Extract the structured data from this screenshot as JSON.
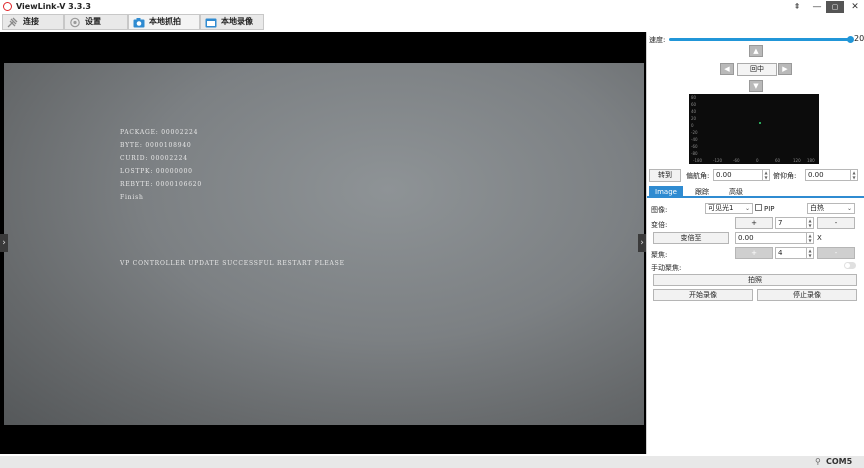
{
  "window": {
    "title": "ViewLink-V 3.3.3",
    "controls": {
      "pin": "⇞",
      "minimize": "—",
      "maximize": "▢",
      "close": "✕"
    }
  },
  "tabs": [
    {
      "label": "连接",
      "icon": "plug-icon"
    },
    {
      "label": "设置",
      "icon": "gear-icon"
    },
    {
      "label": "本地抓拍",
      "icon": "camera-icon"
    },
    {
      "label": "本地录像",
      "icon": "video-icon"
    }
  ],
  "video": {
    "osd_lines": [
      "PACKAGE: 00002224",
      "BYTE: 0000108940",
      "CURID: 00002224",
      "LOSTPK: 00000000",
      "REBYTE: 0000106620",
      "Finish"
    ],
    "message": "VP CONTROLLER UPDATE SUCCESSFUL RESTART PLEASE",
    "left_arrow": "›",
    "right_arrow": "›"
  },
  "panel": {
    "speed": {
      "label": "速度:",
      "value": "20",
      "level_fraction": 1.0
    },
    "ptz": {
      "up": "▲",
      "down": "▼",
      "left": "◀",
      "right": "▶",
      "center": "回中"
    },
    "scope": {
      "y_ticks": [
        "80",
        "60",
        "40",
        "20",
        "0",
        "-20",
        "-40",
        "-60",
        "-80"
      ],
      "x_ticks": [
        "-180",
        "-120",
        "-60",
        "0",
        "60",
        "120",
        "180"
      ]
    },
    "goto": {
      "button": "转到",
      "yaw_label": "偏航角:",
      "yaw_value": "0.00",
      "pitch_label": "俯仰角:",
      "pitch_value": "0.00"
    },
    "subtabs": [
      "Image",
      "跟踪",
      "高级"
    ],
    "image": {
      "image_label": "图像:",
      "image_select": "可见光1",
      "pip_label": "PIP",
      "pip_checked": false,
      "palette_select": "白热",
      "zoom_label": "变倍:",
      "zoom_plus": "+",
      "zoom_value": "7",
      "zoom_minus": "-",
      "zoom_to_button": "变倍至",
      "zoom_to_value": "0.00",
      "zoom_to_unit": "X",
      "focus_label": "聚焦:",
      "focus_plus": "+",
      "focus_value": "4",
      "focus_minus": "-",
      "manual_focus_label": "手动聚焦:",
      "manual_focus_on": false,
      "snapshot_button": "拍照",
      "start_record_button": "开始录像",
      "stop_record_button": "停止录像"
    }
  },
  "status": {
    "port": "COM5",
    "icon": "usb-icon"
  }
}
